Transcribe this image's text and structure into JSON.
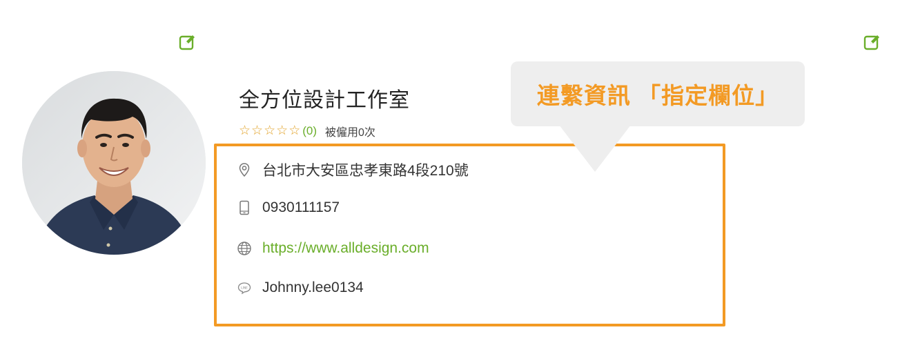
{
  "profile": {
    "company_name": "全方位設計工作室",
    "rating": {
      "stars_filled": 0,
      "stars_total": 5,
      "count_text": "(0)",
      "hired_text": "被僱用0次"
    }
  },
  "contact": {
    "address": "台北市大安區忠孝東路4段210號",
    "phone": "0930111157",
    "website": "https://www.alldesign.com",
    "line_id": "Johnny.lee0134"
  },
  "callout": {
    "text": "連繫資訊 「指定欄位」"
  },
  "icons": {
    "edit": "edit-icon",
    "address": "location-pin-icon",
    "phone": "mobile-phone-icon",
    "website": "globe-icon",
    "line": "line-chat-icon"
  },
  "colors": {
    "accent_green": "#6aae2a",
    "highlight_orange": "#f39a24",
    "star": "#e2a32a",
    "callout_bg": "#eeeeee"
  }
}
